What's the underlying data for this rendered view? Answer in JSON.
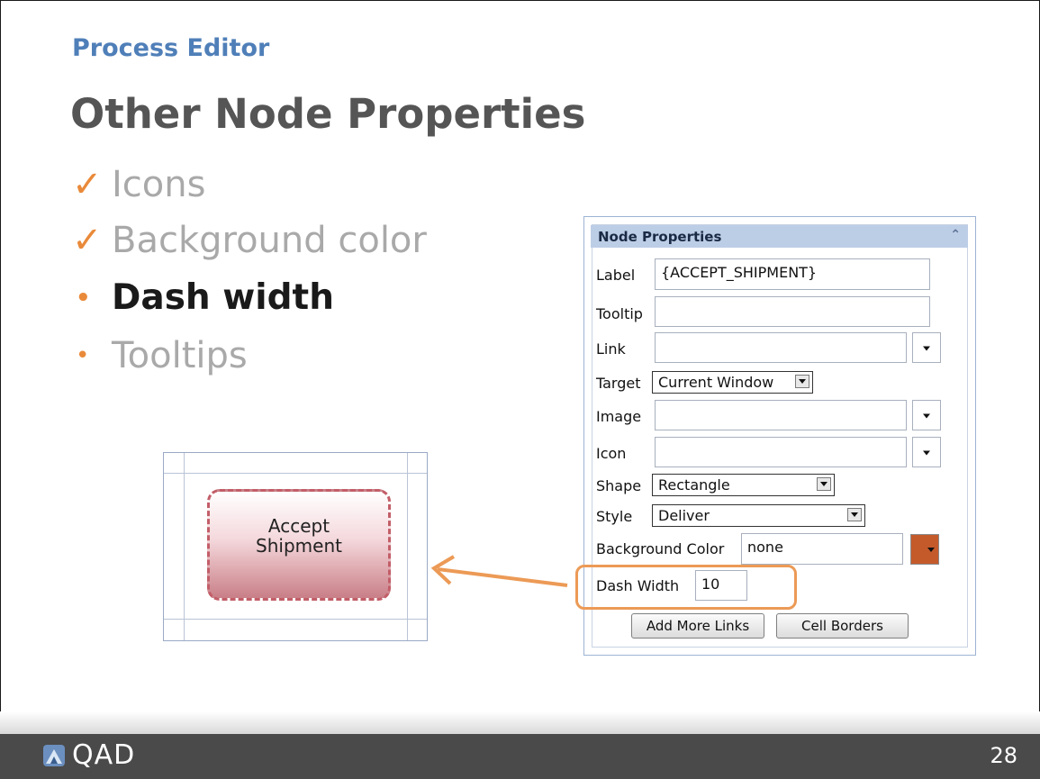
{
  "slide": {
    "kicker": "Process Editor",
    "title": "Other Node Properties",
    "bullets": [
      {
        "mark": "✓",
        "text": "Icons",
        "state": "done"
      },
      {
        "mark": "✓",
        "text": "Background color",
        "state": "done"
      },
      {
        "mark": "•",
        "text": "Dash width",
        "state": "current"
      },
      {
        "mark": "•",
        "text": "Tooltips",
        "state": "upcoming"
      }
    ]
  },
  "preview": {
    "node_label_line1": "Accept",
    "node_label_line2": "Shipment"
  },
  "panel": {
    "title": "Node Properties",
    "collapse_glyph": "⌃",
    "fields": {
      "label": {
        "label": "Label",
        "value": "{ACCEPT_SHIPMENT}"
      },
      "tooltip": {
        "label": "Tooltip",
        "value": ""
      },
      "link": {
        "label": "Link",
        "value": ""
      },
      "target": {
        "label": "Target",
        "value": "Current Window"
      },
      "image": {
        "label": "Image",
        "value": ""
      },
      "icon": {
        "label": "Icon",
        "value": ""
      },
      "shape": {
        "label": "Shape",
        "value": "Rectangle"
      },
      "style": {
        "label": "Style",
        "value": "Deliver"
      },
      "background_color": {
        "label": "Background Color",
        "value": "none",
        "swatch": "#c45a2a"
      },
      "dash_width": {
        "label": "Dash Width",
        "value": "10"
      }
    },
    "buttons": {
      "add_more_links": "Add More Links",
      "cell_borders": "Cell Borders"
    }
  },
  "footer": {
    "brand": "QAD",
    "page_number": "28"
  },
  "colors": {
    "accent_orange": "#ec9a56",
    "kicker_blue": "#4f7fb8",
    "footer_bg": "#4a4a4a"
  }
}
